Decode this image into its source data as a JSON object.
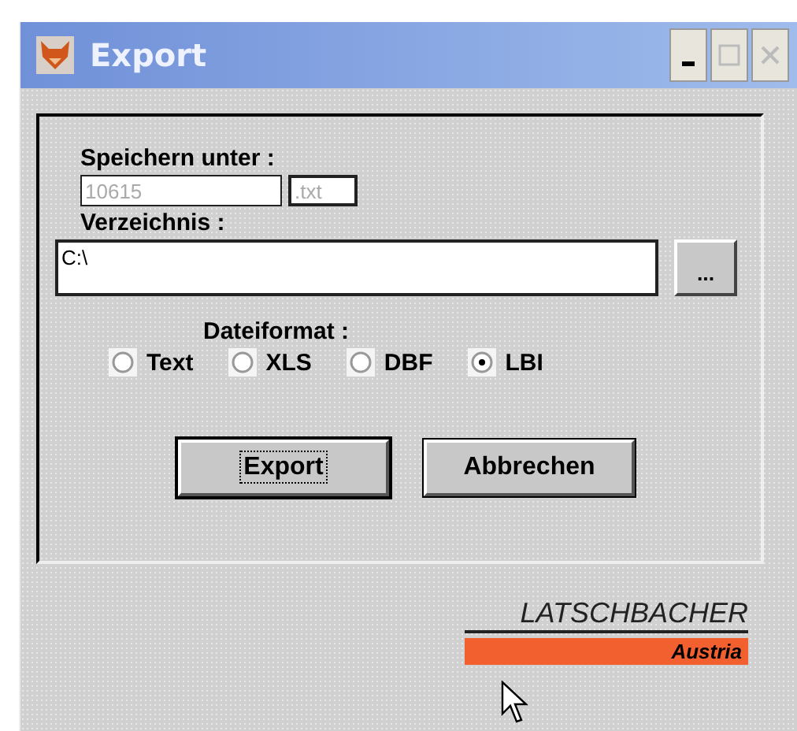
{
  "window": {
    "title": "Export"
  },
  "save_as": {
    "label": "Speichern unter :",
    "name_value": "10615",
    "extension_value": ".txt"
  },
  "directory": {
    "label": "Verzeichnis :",
    "value": "C:\\",
    "browse_button": "..."
  },
  "format": {
    "label": "Dateiformat :",
    "options": [
      {
        "label": "Text",
        "selected": false
      },
      {
        "label": "XLS",
        "selected": false
      },
      {
        "label": "DBF",
        "selected": false
      },
      {
        "label": "LBI",
        "selected": true
      }
    ]
  },
  "buttons": [
    {
      "label": "Export",
      "default": true
    },
    {
      "label": "Abbrechen",
      "default": false
    }
  ],
  "logo": {
    "brand": "LATSCHBACHER",
    "country": "Austria"
  }
}
